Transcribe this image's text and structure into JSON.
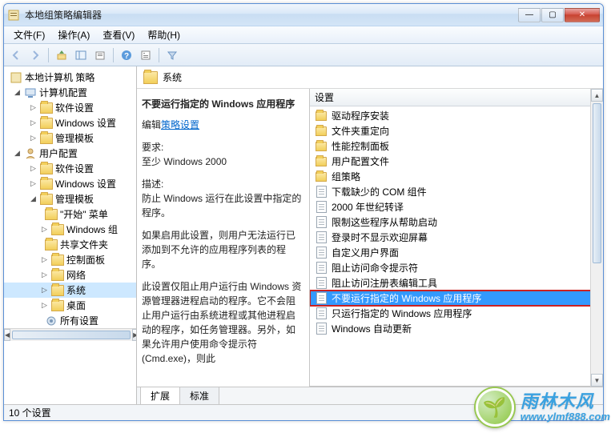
{
  "window": {
    "title": "本地组策略编辑器",
    "controls": {
      "min": "—",
      "max": "▢",
      "close": "✕"
    }
  },
  "menu": {
    "file": "文件(F)",
    "action": "操作(A)",
    "view": "查看(V)",
    "help": "帮助(H)"
  },
  "tree": {
    "root": "本地计算机 策略",
    "computer_config": "计算机配置",
    "cc_software": "软件设置",
    "cc_windows": "Windows 设置",
    "cc_admin": "管理模板",
    "user_config": "用户配置",
    "uc_software": "软件设置",
    "uc_windows": "Windows 设置",
    "uc_admin": "管理模板",
    "start_menu": "\"开始\" 菜单",
    "windows_components": "Windows 组",
    "shared_folders": "共享文件夹",
    "control_panel": "控制面板",
    "network": "网络",
    "system": "系统",
    "desktop": "桌面",
    "all_settings": "所有设置"
  },
  "rightpane": {
    "header": "系统",
    "column": "设置"
  },
  "desc": {
    "title": "不要运行指定的 Windows 应用程序",
    "edit_prefix": "编辑",
    "edit_link": "策略设置",
    "req_label": "要求:",
    "req_text": "至少 Windows 2000",
    "desc_label": "描述:",
    "desc_p1": "防止 Windows 运行在此设置中指定的程序。",
    "desc_p2": "如果启用此设置，则用户无法运行已添加到不允许的应用程序列表的程序。",
    "desc_p3": "此设置仅阻止用户运行由 Windows 资源管理器进程启动的程序。它不会阻止用户运行由系统进程或其他进程启动的程序，如任务管理器。另外，如果允许用户使用命令提示符(Cmd.exe)，则此"
  },
  "items": [
    {
      "type": "folder",
      "label": "驱动程序安装"
    },
    {
      "type": "folder",
      "label": "文件夹重定向"
    },
    {
      "type": "folder",
      "label": "性能控制面板"
    },
    {
      "type": "folder",
      "label": "用户配置文件"
    },
    {
      "type": "folder",
      "label": "组策略"
    },
    {
      "type": "setting",
      "label": "下载缺少的 COM 组件"
    },
    {
      "type": "setting",
      "label": "2000 年世纪转译"
    },
    {
      "type": "setting",
      "label": "限制这些程序从帮助启动"
    },
    {
      "type": "setting",
      "label": "登录时不显示欢迎屏幕"
    },
    {
      "type": "setting",
      "label": "自定义用户界面"
    },
    {
      "type": "setting",
      "label": "阻止访问命令提示符"
    },
    {
      "type": "setting",
      "label": "阻止访问注册表编辑工具"
    },
    {
      "type": "setting",
      "label": "不要运行指定的 Windows 应用程序",
      "highlighted": true
    },
    {
      "type": "setting",
      "label": "只运行指定的 Windows 应用程序"
    },
    {
      "type": "setting",
      "label": "Windows 自动更新"
    }
  ],
  "tabs": {
    "extended": "扩展",
    "standard": "标准"
  },
  "statusbar": "10 个设置",
  "watermark": {
    "brand": "雨林木风",
    "url": "www.ylmf888.com",
    "sprout": "🌱"
  }
}
